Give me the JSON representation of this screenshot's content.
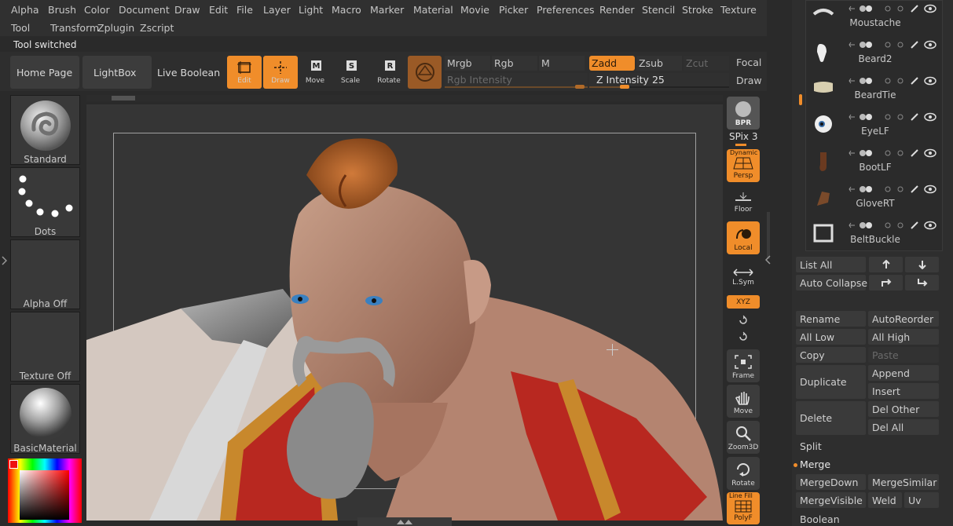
{
  "menu_row1": [
    "Alpha",
    "Brush",
    "Color",
    "Document",
    "Draw",
    "Edit",
    "File",
    "Layer",
    "Light",
    "Macro",
    "Marker",
    "Material",
    "Movie",
    "Picker",
    "Preferences",
    "Render",
    "Stencil",
    "Stroke",
    "Texture"
  ],
  "menu_row2": [
    "Tool",
    "Transform",
    "Zplugin",
    "Zscript"
  ],
  "status_message": "Tool switched",
  "top_buttons": {
    "home": "Home Page",
    "lightbox": "LightBox",
    "live_boolean": "Live Boolean"
  },
  "tools": {
    "edit": "Edit",
    "draw": "Draw",
    "move": "Move",
    "scale": "Scale",
    "rotate": "Rotate"
  },
  "color_modes": {
    "mrgb": "Mrgb",
    "rgb": "Rgb",
    "m": "M",
    "rgb_intensity": "Rgb Intensity"
  },
  "z_modes": {
    "zadd": "Zadd",
    "zsub": "Zsub",
    "zcut": "Zcut",
    "z_intensity_label": "Z Intensity",
    "z_intensity_value": "25",
    "z_intensity_fraction": 0.25,
    "rgb_intensity_fraction": 1.0
  },
  "focal": {
    "focal": "Focal S",
    "draw": "Draw"
  },
  "left_shelf": {
    "brush": "Standard",
    "stroke": "Dots",
    "alpha": "Alpha Off",
    "texture": "Texture Off",
    "material": "BasicMaterial"
  },
  "right_shelf": {
    "bpr": "BPR",
    "spix": "SPix 3",
    "persp_top": "Dynamic",
    "persp": "Persp",
    "floor": "Floor",
    "local": "Local",
    "lsym": "L.Sym",
    "xyz": "XYZ",
    "frame": "Frame",
    "move": "Move",
    "zoom3d": "Zoom3D",
    "rotate": "Rotate",
    "polyf_top": "Line Fill",
    "polyf": "PolyF"
  },
  "subtools": [
    "Moustache",
    "Beard2",
    "BeardTie",
    "EyeLF",
    "BootLF",
    "GloveRT",
    "BeltBuckle"
  ],
  "subtool_panel": {
    "list_all": "List All",
    "auto_collapse": "Auto Collapse",
    "rename": "Rename",
    "auto_reorder": "AutoReorder",
    "all_low": "All Low",
    "all_high": "All High",
    "copy": "Copy",
    "paste": "Paste",
    "duplicate": "Duplicate",
    "append": "Append",
    "insert": "Insert",
    "delete": "Delete",
    "del_other": "Del Other",
    "del_all": "Del All",
    "split": "Split",
    "merge": "Merge",
    "merge_down": "MergeDown",
    "merge_similar": "MergeSimilar",
    "merge_visible": "MergeVisible",
    "weld": "Weld",
    "uv": "Uv",
    "boolean": "Boolean"
  },
  "colors": {
    "accent": "#f08d2a",
    "panel": "#3a3a3a",
    "background": "#2a2a2a",
    "canvas": "#353535"
  }
}
